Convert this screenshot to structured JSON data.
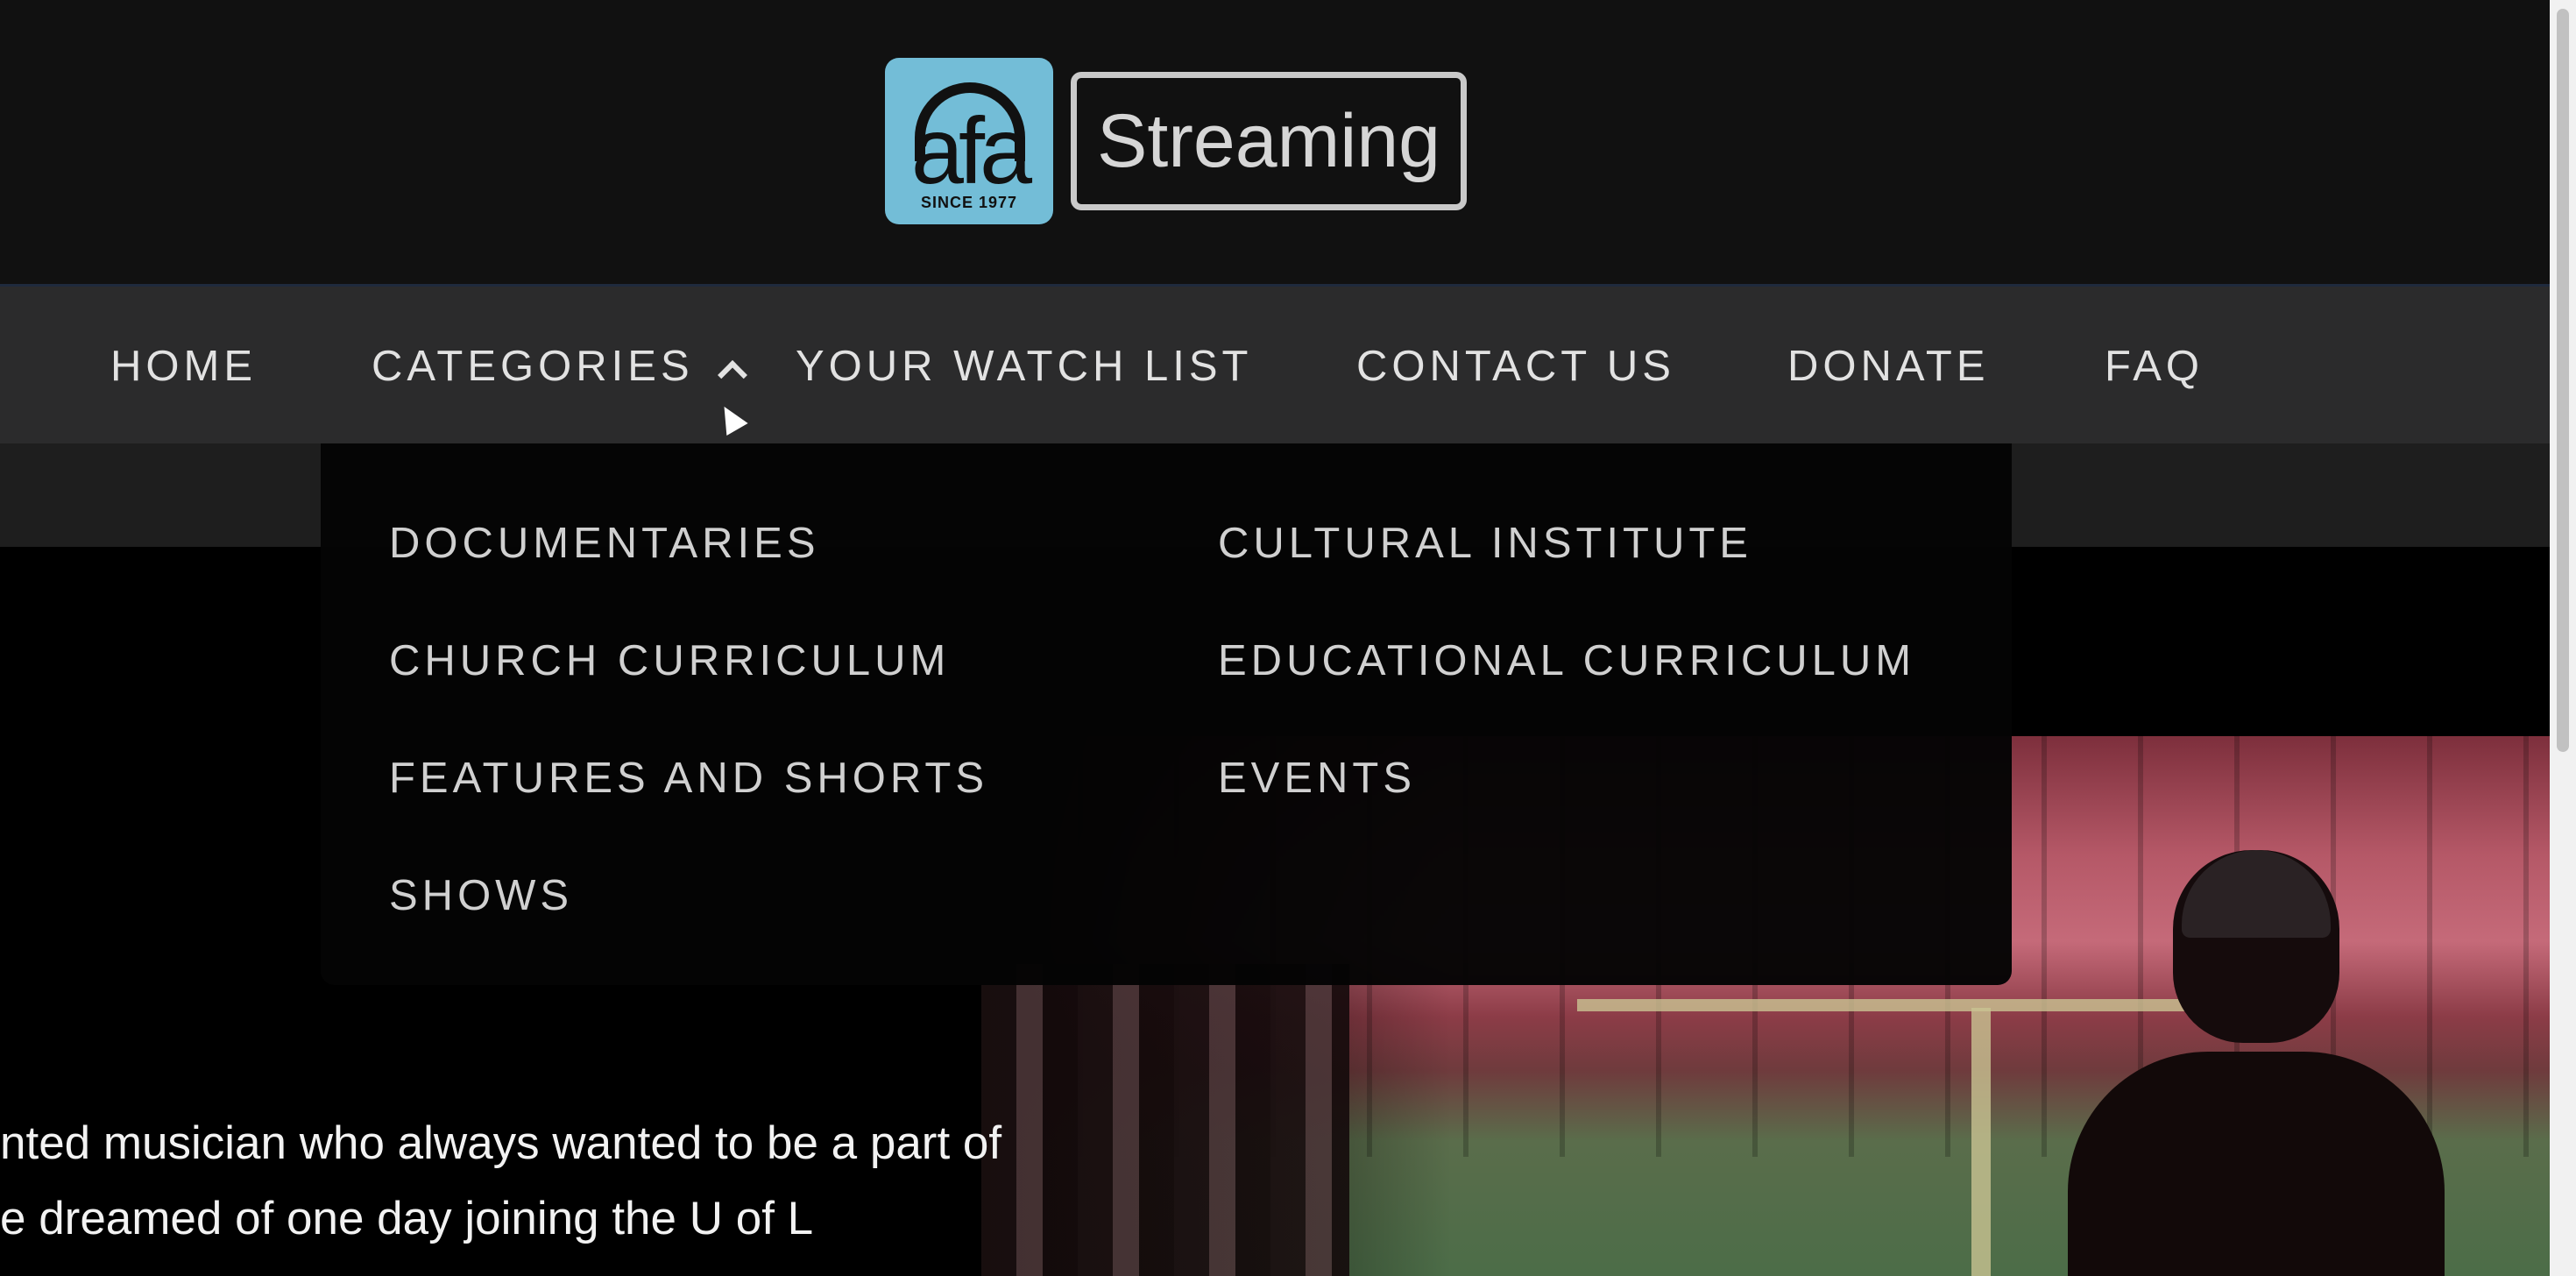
{
  "header": {
    "logo": {
      "badge_text": "afa",
      "since_text": "SINCE 1977",
      "word": "Streaming"
    }
  },
  "nav": {
    "items": [
      {
        "label": "HOME"
      },
      {
        "label": "CATEGORIES"
      },
      {
        "label": "YOUR WATCH LIST"
      },
      {
        "label": "CONTACT US"
      },
      {
        "label": "DONATE"
      },
      {
        "label": "FAQ"
      }
    ]
  },
  "categories_menu": {
    "items": [
      {
        "label": "DOCUMENTARIES"
      },
      {
        "label": "CULTURAL INSTITUTE"
      },
      {
        "label": "CHURCH CURRICULUM"
      },
      {
        "label": "EDUCATIONAL CURRICULUM"
      },
      {
        "label": "FEATURES AND SHORTS"
      },
      {
        "label": "EVENTS"
      },
      {
        "label": "SHOWS"
      }
    ]
  },
  "hero": {
    "lines": [
      "nted musician who always wanted to be a part of",
      "e dreamed of one day joining the U of L"
    ]
  },
  "icons": {
    "categories_toggle": "chevron-up-icon",
    "pointer": "mouse-cursor-icon"
  },
  "colors": {
    "header_bg": "#111111",
    "nav_bg": "#2b2b2c",
    "dropdown_bg": "#040404",
    "logo_blue": "#73bdd7"
  }
}
